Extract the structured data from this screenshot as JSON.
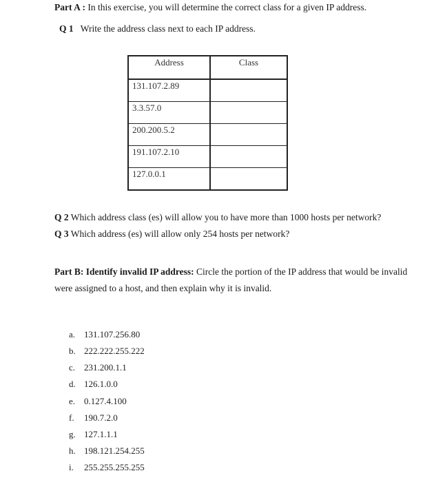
{
  "partA": {
    "heading": "Part A :",
    "text": " In this exercise, you will determine the correct class for a given IP address."
  },
  "q1": {
    "label": "Q 1",
    "text": "Write the address class next to each IP address."
  },
  "table": {
    "headers": [
      "Address",
      "Class"
    ],
    "rows": [
      {
        "address": "131.107.2.89",
        "class": ""
      },
      {
        "address": "3.3.57.0",
        "class": ""
      },
      {
        "address": "200.200.5.2",
        "class": ""
      },
      {
        "address": "191.107.2.10",
        "class": ""
      },
      {
        "address": "127.0.0.1",
        "class": ""
      }
    ]
  },
  "q2": {
    "label": "Q 2",
    "text": " Which address class (es) will allow you to have more than 1000 hosts per network?"
  },
  "q3": {
    "label": "Q 3",
    "text": " Which address (es) will allow only 254 hosts per network?"
  },
  "partB": {
    "heading": "Part B: Identify invalid IP address:",
    "text_line1": " Circle the portion of the IP address that would be invalid",
    "text_line2": "were assigned to a host, and then explain why it is invalid.",
    "items": [
      {
        "label": "a.",
        "address": "131.107.256.80"
      },
      {
        "label": "b.",
        "address": "222.222.255.222"
      },
      {
        "label": "c.",
        "address": "231.200.1.1"
      },
      {
        "label": "d.",
        "address": "126.1.0.0"
      },
      {
        "label": "e.",
        "address": "0.127.4.100"
      },
      {
        "label": "f.",
        "address": "190.7.2.0"
      },
      {
        "label": "g.",
        "address": "127.1.1.1"
      },
      {
        "label": "h.",
        "address": "198.121.254.255"
      },
      {
        "label": "i.",
        "address": "255.255.255.255"
      }
    ]
  }
}
